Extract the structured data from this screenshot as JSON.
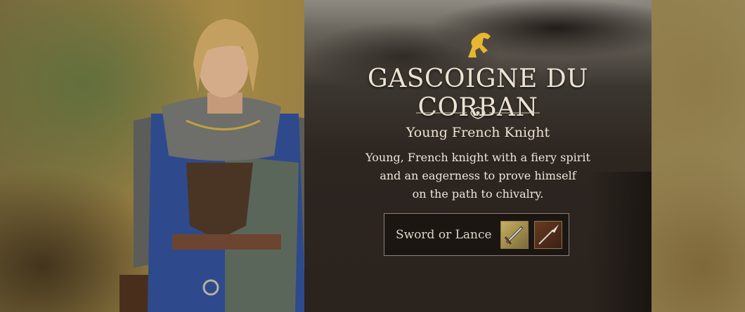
{
  "character": {
    "name": "GASCOIGNE DU CORBAN",
    "subtitle": "Young French Knight",
    "description_lines": [
      "Young, French knight with a fiery spirit",
      "and an eagerness to prove himself",
      "on the path to chivalry."
    ]
  },
  "weapons": {
    "label": "Sword or Lance",
    "icons": [
      "sword-icon",
      "lance-icon"
    ]
  },
  "colors": {
    "emblem_gold": "#e8b630",
    "title_text": "#ece3d3",
    "panel_bg": "#2b231e"
  }
}
